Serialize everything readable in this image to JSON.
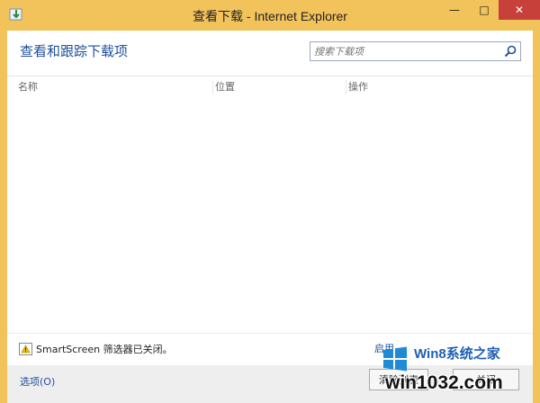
{
  "window": {
    "title": "查看下载 - Internet Explorer",
    "minimize_glyph": "—",
    "maximize_glyph": "□",
    "close_glyph": "✕"
  },
  "main": {
    "heading": "查看和跟踪下载项",
    "search_placeholder": "搜索下载项",
    "columns": [
      "名称",
      "位置",
      "操作"
    ],
    "downloads": []
  },
  "smartscreen": {
    "status_text": "SmartScreen 筛选器已关闭。",
    "enable_link": "启用"
  },
  "footer": {
    "options_link": "选项(O)",
    "clear_button": "清除列表",
    "close_button": "关闭"
  },
  "watermark": {
    "site_name": "Win8系统之家",
    "url": "win1032.com"
  },
  "colors": {
    "frame": "#f2c25b",
    "heading": "#1e4e9c",
    "close_button": "#c7413a"
  }
}
